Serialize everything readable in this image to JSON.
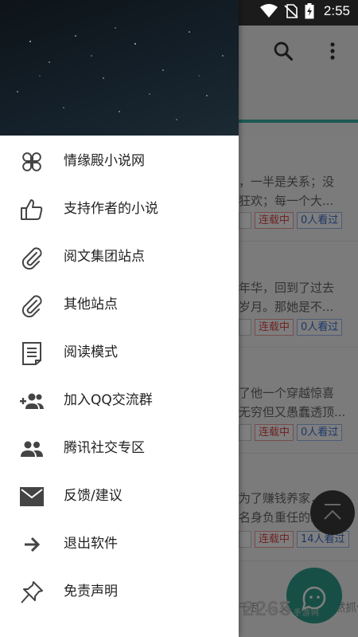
{
  "status_bar": {
    "time": "2:55"
  },
  "background": {
    "novels": [
      {
        "desc": [
          "，一半是关系；没",
          "狂欢；每一个大..."
        ],
        "tags": [
          "",
          "连载中",
          "0人看过"
        ]
      },
      {
        "desc": [
          "年华，回到了过去",
          "岁月。那她是不..."
        ],
        "tags": [
          "",
          "连载中",
          "0人看过"
        ]
      },
      {
        "desc": [
          "了他一个穿越惊喜",
          "无穷但又愚蠢透顶..."
        ],
        "tags": [
          "",
          "连载中",
          "0人看过"
        ]
      },
      {
        "desc": [
          "为了赚钱养家，进",
          "名身负重任的经..."
        ],
        "tags": [
          "",
          "连载中",
          "14人看过"
        ]
      }
    ],
    "bottom_text": "千瓦  ...  又不已。既然抓住...",
    "watermark": "2265",
    "watermark_sub": "手游网"
  },
  "drawer": {
    "menu": [
      {
        "label": "情缘殿小说网",
        "icon": "clover-icon"
      },
      {
        "label": "支持作者的小说",
        "icon": "thumbs-up-icon"
      },
      {
        "label": "阅文集团站点",
        "icon": "paperclip-icon"
      },
      {
        "label": "其他站点",
        "icon": "paperclip-icon"
      },
      {
        "label": "阅读模式",
        "icon": "document-icon"
      },
      {
        "label": "加入QQ交流群",
        "icon": "group-add-icon"
      },
      {
        "label": "腾讯社交专区",
        "icon": "people-icon"
      },
      {
        "label": "反馈/建议",
        "icon": "mail-icon"
      },
      {
        "label": "退出软件",
        "icon": "arrow-right-icon"
      },
      {
        "label": "免责声明",
        "icon": "pin-icon"
      }
    ]
  },
  "colors": {
    "accent": "#39b3a3",
    "fab": "#2f9e8d",
    "tag_red": "#e04a4a",
    "tag_blue": "#3a6fd0"
  }
}
